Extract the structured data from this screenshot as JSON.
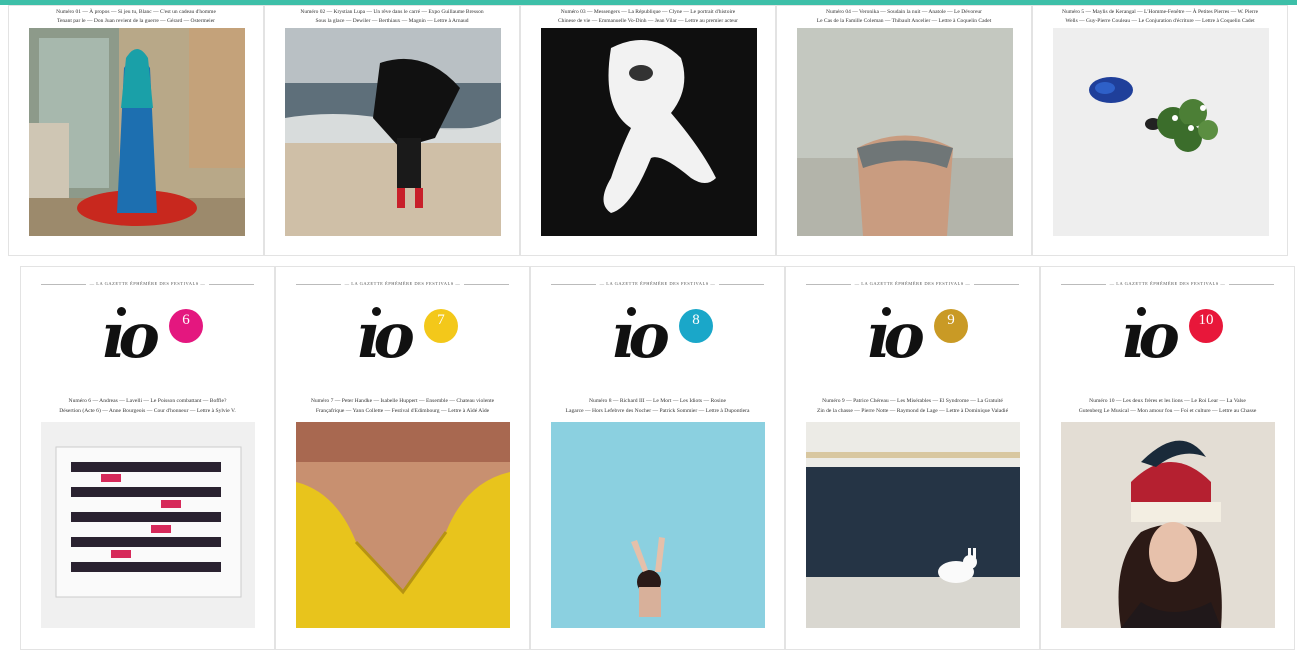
{
  "accent_bar_color": "#3dbfa8",
  "row1": [
    {
      "lines": [
        "Numéro 01 — À propos — Si jeu tu, Blanc — C'est un cadeau d'homme",
        "Tenant par le — Don Juan revient de la guerre — Gérard — Ostermeier"
      ],
      "num_color": "#2bb4a0",
      "photo_alt": "woman-blue-veil-photo"
    },
    {
      "lines": [
        "Numéro 02 — Krystian Lupa — Un rêve dans le carré — Expo Guillaume Bresson",
        "Sous la glace — Dewiler — Berthiaux — Magnin — Lettre à Arnaud"
      ],
      "num_color": "#e4177f",
      "photo_alt": "umbrella-beach-photo"
    },
    {
      "lines": [
        "Numéro 03 — Messengers — La République — Clyne — Le portrait d'histoire",
        "Chinese de vie — Emmanuelle Vo-Dinh — Jean Vilar — Lettre au premier acteur"
      ],
      "num_color": "#1aa7c9",
      "photo_alt": "white-smoke-figure-photo"
    },
    {
      "lines": [
        "Numéro 04 — Veronika — Soudain la nuit — Anatole — Le Dévoreur",
        "Le Cas de la Famille Coleman — Thibault Ancelier — Lettre à Coquelin Cadet"
      ],
      "num_color": "#e0a81b",
      "photo_alt": "bent-back-figure-photo"
    },
    {
      "lines": [
        "Numéro 5 — Maylis de Kerangal — L'Homme-Fenêtre — À Petites Pierres — W. Pierre",
        "Wells — Guy-Pierre Couleau — Le Conjuration d'écriture — Lettre à Coquelin Cadet"
      ],
      "num_color": "#2bb4a0",
      "photo_alt": "blue-ink-and-plant-photo"
    }
  ],
  "masthead_title": "— LA GAZETTE ÉPHÉMÈRE DES FESTIVALS —",
  "logo_text": "ıo",
  "row2": [
    {
      "issue": "6",
      "disc_color": "#e4177f",
      "lines": [
        "Numéro 6 — Andreas — Lavelli — Le Poisson combattant — Boffle?",
        "Désertion (Acte 6) — Anne Bourgeois — Cour d'honneur — Lettre à Sylvie V."
      ],
      "num_color": "#e4177f",
      "photo_alt": "mirrored-dancers-collage-photo"
    },
    {
      "issue": "7",
      "disc_color": "#f3c81a",
      "lines": [
        "Numéro 7 — Peter Handke — Isabelle Huppert — Ensemble — Chateau violente",
        "Françafrique — Yann Collette — Festival d'Edimbourg — Lettre à Aïdé Aïde"
      ],
      "num_color": "#e0a81b",
      "photo_alt": "yellow-dress-photo"
    },
    {
      "issue": "8",
      "disc_color": "#1aa7c9",
      "lines": [
        "Numéro 8 — Richard III — Le Mort — Les Idiots — Rosine",
        "Lagarce — Hors Lefebvre des Nocher — Patrick Sommier — Lettre à Dupontlera"
      ],
      "num_color": "#1aa7c9",
      "photo_alt": "swimmer-in-blue-photo"
    },
    {
      "issue": "9",
      "disc_color": "#c99a25",
      "lines": [
        "Numéro 9 — Patrice Chéreau — Les Misérables — El Syndrome — La Gratuité",
        "Zin de la chasse — Pierre Notte — Raymond de Lage — Lettre à Dominique Valadié"
      ],
      "num_color": "#c99a25",
      "photo_alt": "white-rabbit-photo"
    },
    {
      "issue": "10",
      "disc_color": "#e8173a",
      "lines": [
        "Numéro 10 — Les deux frères et les lions — Le Roi Lear — La Valse",
        "Gutenberg Le Musical — Mon amour fou — Foi et culture — Lettre au Chasse"
      ],
      "num_color": "#e8173a",
      "photo_alt": "hat-woman-portrait-photo"
    }
  ]
}
